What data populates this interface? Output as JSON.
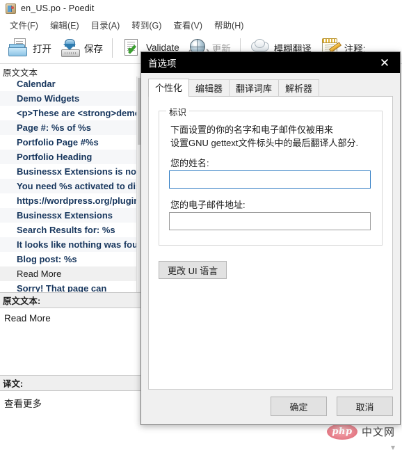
{
  "window": {
    "title": "en_US.po - Poedit",
    "app_icon": "poedit-icon"
  },
  "menubar": {
    "items": [
      {
        "label": "文件(F)"
      },
      {
        "label": "编辑(E)"
      },
      {
        "label": "目录(A)"
      },
      {
        "label": "转到(G)"
      },
      {
        "label": "查看(V)"
      },
      {
        "label": "帮助(H)"
      }
    ]
  },
  "toolbar": {
    "buttons": [
      {
        "label": "打开",
        "icon": "open-folder-icon",
        "disabled": false
      },
      {
        "label": "保存",
        "icon": "save-disk-icon",
        "disabled": false
      },
      {
        "label": "Validate",
        "icon": "validate-check-icon",
        "disabled": false
      },
      {
        "label": "更新",
        "icon": "globe-update-icon",
        "disabled": true
      },
      {
        "label": "模糊翻译",
        "icon": "cloud-translate-icon",
        "disabled": false
      },
      {
        "label": "注释:",
        "icon": "notes-pencil-icon",
        "disabled": false
      }
    ]
  },
  "list": {
    "column_header": "原文文本",
    "rows": [
      {
        "text": "Calendar",
        "translated": false
      },
      {
        "text": "Demo Widgets",
        "translated": false
      },
      {
        "text": "<p>These are <strong>demo",
        "translated": false
      },
      {
        "text": "Page #: %s of %s",
        "translated": false
      },
      {
        "text": "Portfolio Page #%s",
        "translated": false
      },
      {
        "text": "Portfolio Heading",
        "translated": false
      },
      {
        "text": "Businessx Extensions is not a",
        "translated": false
      },
      {
        "text": "You need %s activated to disp",
        "translated": false
      },
      {
        "text": "https://wordpress.org/plugin",
        "translated": false
      },
      {
        "text": "Businessx Extensions",
        "translated": false
      },
      {
        "text": "Search Results for: %s",
        "translated": false
      },
      {
        "text": "It looks like nothing was foun",
        "translated": false
      },
      {
        "text": "Blog post: %s",
        "translated": false
      },
      {
        "text": "Read More",
        "translated": true
      },
      {
        "text": "Sorry! That page can",
        "translated": false
      }
    ]
  },
  "source_pane": {
    "header": "原文文本:",
    "content": "Read More"
  },
  "translation_pane": {
    "header": "译文:",
    "content": "查看更多"
  },
  "dialog": {
    "title": "首选项",
    "close_icon": "close-icon",
    "tabs": [
      {
        "label": "个性化",
        "active": true
      },
      {
        "label": "编辑器",
        "active": false
      },
      {
        "label": "翻译词库",
        "active": false
      },
      {
        "label": "解析器",
        "active": false
      }
    ],
    "identity": {
      "group_title": "标识",
      "description_line1": "下面设置的你的名字和电子邮件仅被用来",
      "description_line2": "设置GNU gettext文件标头中的最后翻译人部分.",
      "name_label": "您的姓名:",
      "name_value": "",
      "email_label": "您的电子邮件地址:",
      "email_value": ""
    },
    "ui_language_button": "更改 UI 语言",
    "ok_button": "确定",
    "cancel_button": "取消"
  },
  "watermark": {
    "logo_text": "php",
    "site_text": "中文网"
  },
  "colors": {
    "untranslated_text": "#17365d",
    "dialog_titlebar": "#000000",
    "focus_border": "#2b79c2",
    "php_pink": "#d9606f"
  }
}
